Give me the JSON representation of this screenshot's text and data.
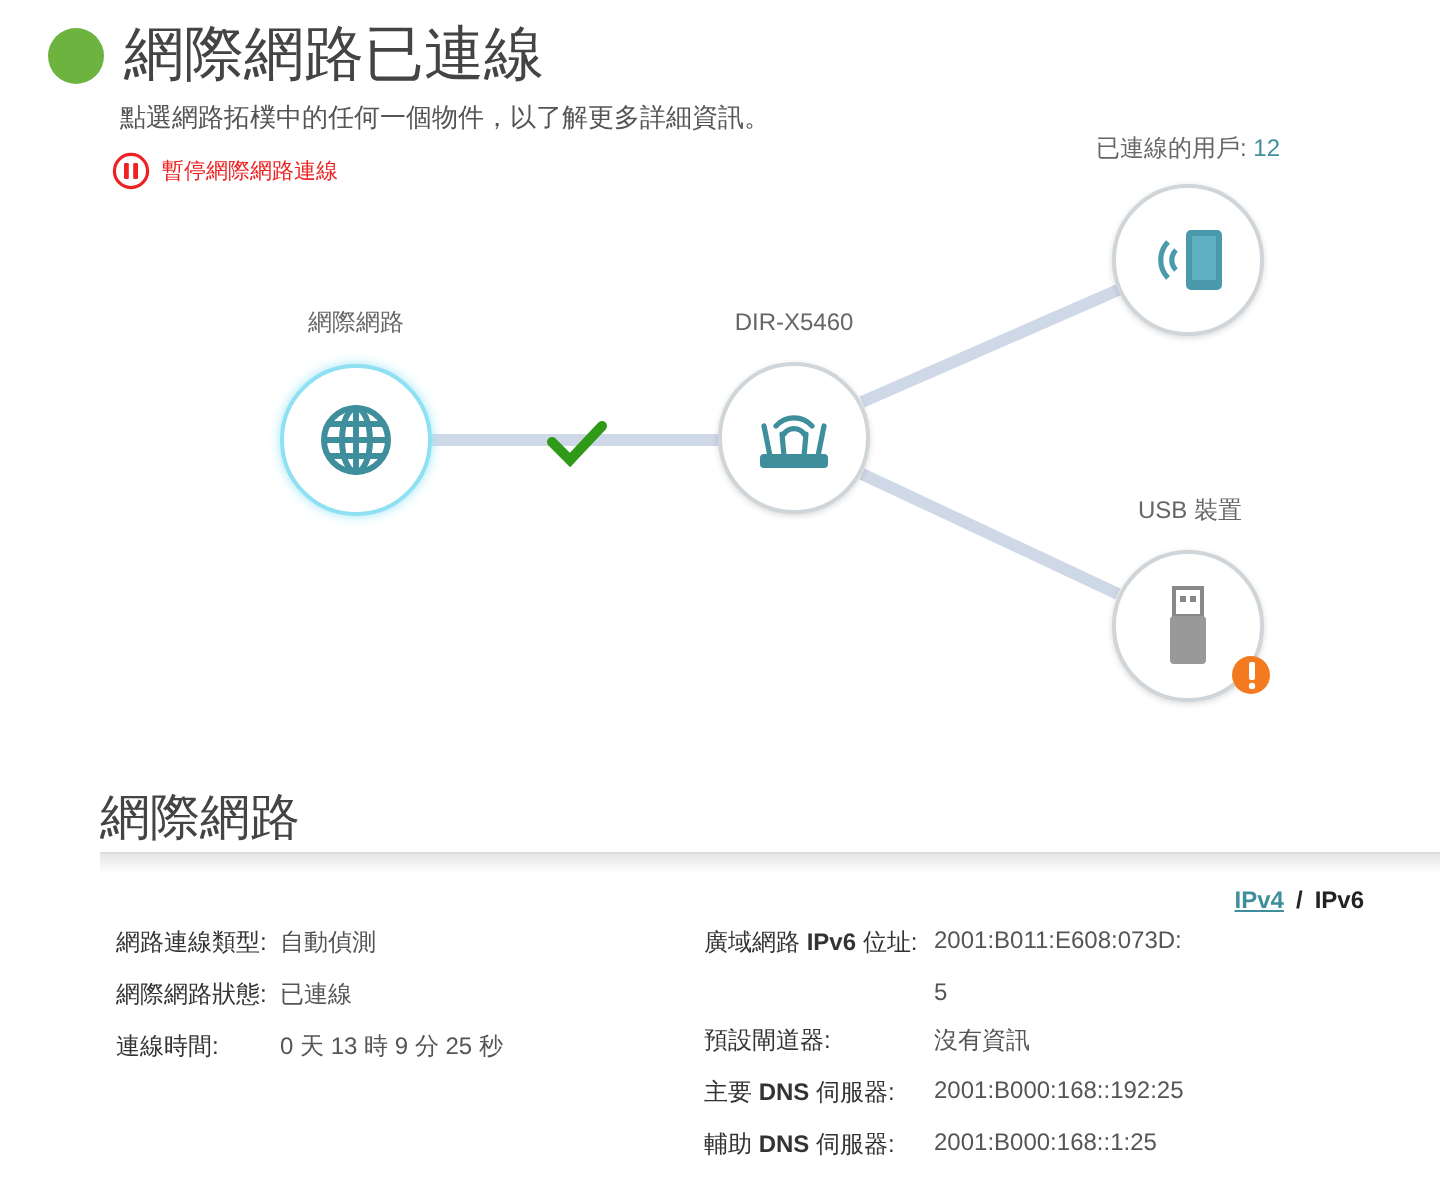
{
  "header": {
    "title": "網際網路已連線",
    "subtitle": "點選網路拓樸中的任何一個物件，以了解更多詳細資訊。",
    "pause_link": "暫停網際網路連線"
  },
  "topology": {
    "internet": {
      "label": "網際網路",
      "connected": true
    },
    "router": {
      "label": "DIR-X5460"
    },
    "clients": {
      "label": "已連線的用戶:",
      "count": "12"
    },
    "usb": {
      "label": "USB 裝置",
      "warning": true
    }
  },
  "section": {
    "title": "網際網路",
    "tab_separator": "/",
    "tabs": [
      {
        "label": "IPv4",
        "selected": false
      },
      {
        "label": "IPv6",
        "selected": true
      }
    ],
    "left_rows": [
      {
        "label": "網路連線類型:",
        "value": "自動偵測"
      },
      {
        "label": "網際網路狀態:",
        "value": "已連線"
      },
      {
        "label": "連線時間:",
        "value": "0 天 13 時 9 分 25 秒"
      }
    ],
    "right_rows": [
      {
        "label": "廣域網路 **IPv6** 位址:",
        "value": "2001:B011:E608:073D:",
        "continuation": "5"
      },
      {
        "label": "預設閘道器:",
        "value": "沒有資訊"
      },
      {
        "label": "主要 **DNS** 伺服器:",
        "value": "2001:B000:168::192:25"
      },
      {
        "label": "輔助 **DNS** 伺服器:",
        "value": "2001:B000:168::1:25"
      }
    ]
  }
}
